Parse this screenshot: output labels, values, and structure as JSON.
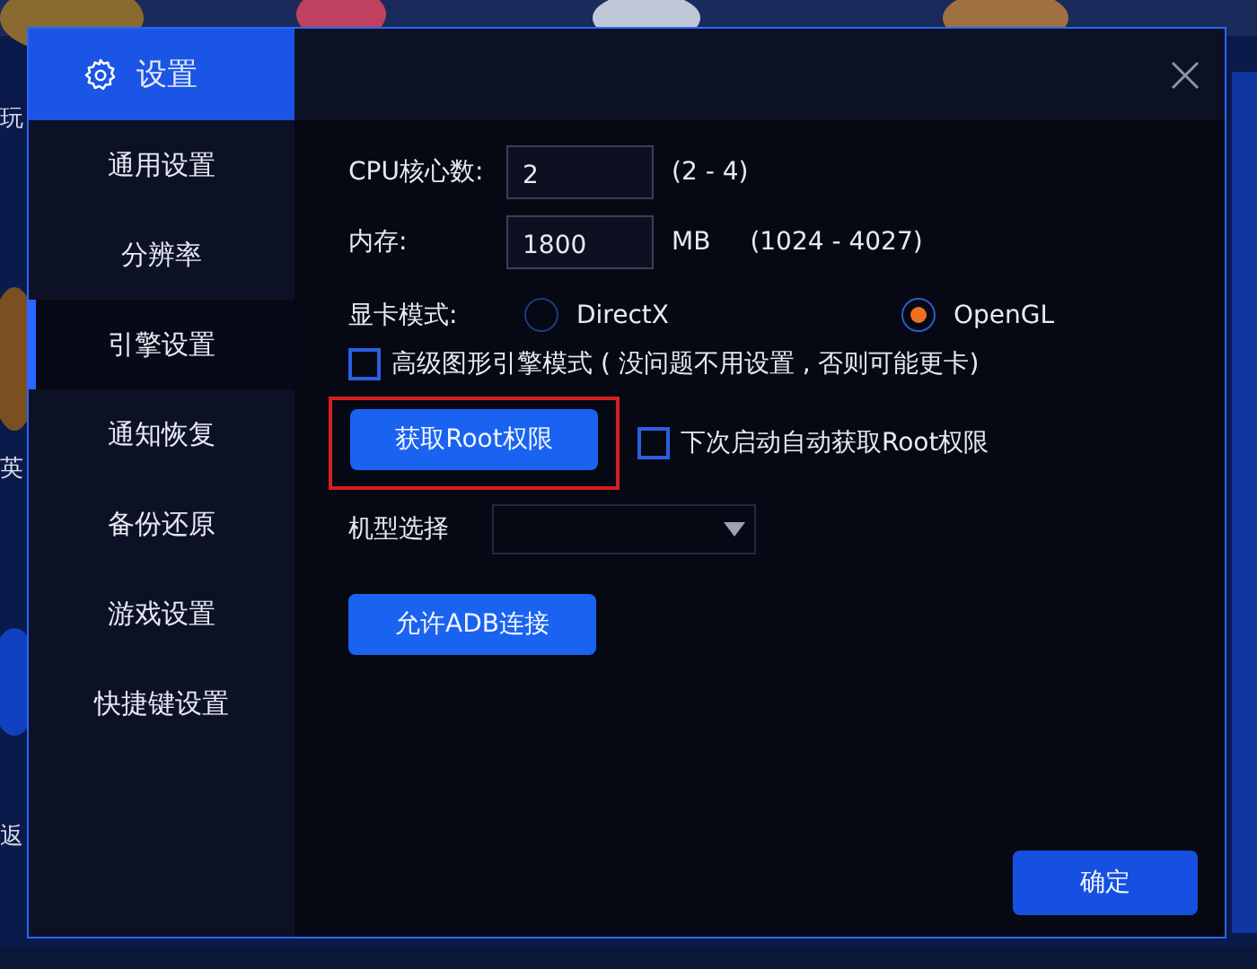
{
  "background": {
    "edge_labels": [
      "玩",
      "英",
      "返"
    ]
  },
  "window": {
    "title": "设置"
  },
  "sidebar": {
    "items": [
      {
        "label": "通用设置",
        "selected": false
      },
      {
        "label": "分辨率",
        "selected": false
      },
      {
        "label": "引擎设置",
        "selected": true
      },
      {
        "label": "通知恢复",
        "selected": false
      },
      {
        "label": "备份还原",
        "selected": false
      },
      {
        "label": "游戏设置",
        "selected": false
      },
      {
        "label": "快捷键设置",
        "selected": false
      }
    ]
  },
  "engine": {
    "cpu": {
      "label": "CPU核心数:",
      "value": "2",
      "range": "(2 - 4)"
    },
    "memory": {
      "label": "内存:",
      "value": "1800",
      "unit": "MB",
      "range": "(1024 - 4027)"
    },
    "graphics": {
      "label": "显卡模式:",
      "options": [
        {
          "label": "DirectX",
          "selected": false
        },
        {
          "label": "OpenGL",
          "selected": true
        }
      ]
    },
    "advanced": {
      "label": "高级图形引擎模式 ( 没问题不用设置 , 否则可能更卡)",
      "checked": false
    },
    "root_button": {
      "label": "获取Root权限",
      "highlighted": true
    },
    "auto_root": {
      "label": "下次启动自动获取Root权限",
      "checked": false
    },
    "model": {
      "label": "机型选择"
    },
    "adb_button": {
      "label": "允许ADB连接"
    }
  },
  "ok_button": {
    "label": "确定"
  }
}
